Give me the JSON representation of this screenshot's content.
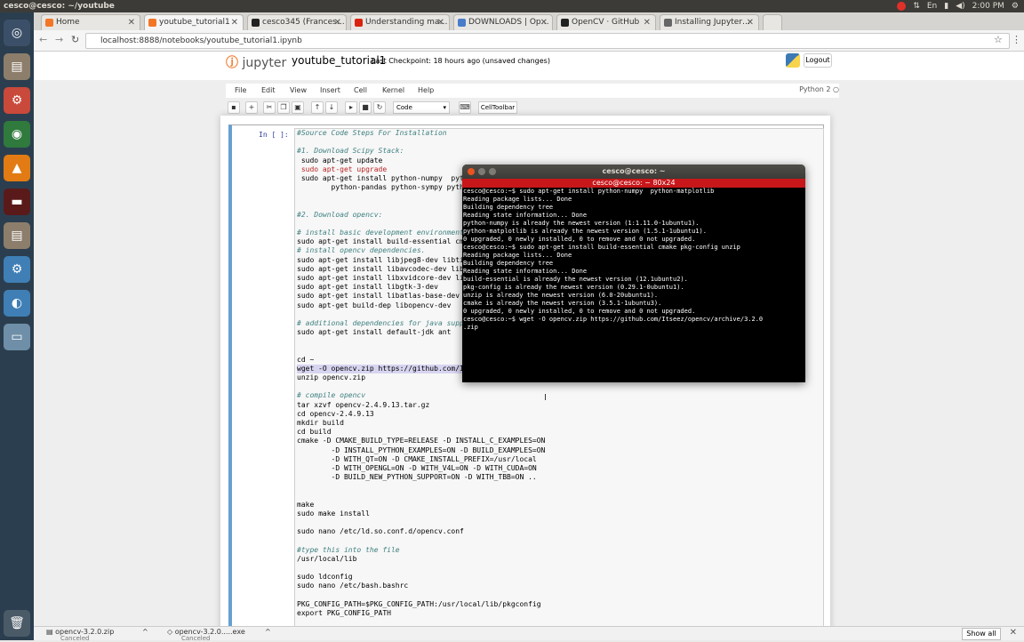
{
  "os": {
    "window_title": "cesco@cesco: ~/youtube",
    "time": "2:00 PM",
    "keyboard": "En",
    "launcher_icons": [
      "ubuntu-icon",
      "files-icon",
      "settings-icon",
      "chrome-icon",
      "vlc-icon",
      "terminal-icon",
      "files-icon",
      "settings-icon",
      "network-icon",
      "disk-icon",
      "trash-icon"
    ]
  },
  "browser": {
    "tabs": [
      {
        "label": "Home",
        "icon_color": "#f37626"
      },
      {
        "label": "youtube_tutorial1",
        "icon_color": "#f37626"
      },
      {
        "label": "cesco345 (Frances…",
        "icon_color": "#222222"
      },
      {
        "label": "Understanding ma…",
        "icon_color": "#d9230f"
      },
      {
        "label": "DOWNLOADS | Op…",
        "icon_color": "#4a7dc9"
      },
      {
        "label": "OpenCV · GitHub",
        "icon_color": "#222222"
      },
      {
        "label": "Installing Jupyter…",
        "icon_color": "#666666"
      }
    ],
    "url": "localhost:8888/notebooks/youtube_tutorial1.ipynb"
  },
  "jupyter": {
    "logo": "jupyter",
    "notebook_name": "youtube_tutorial1",
    "checkpoint": "Last Checkpoint: 18 hours ago (unsaved changes)",
    "logout": "Logout",
    "menus": [
      "File",
      "Edit",
      "View",
      "Insert",
      "Cell",
      "Kernel",
      "Help"
    ],
    "kernel": "Python 2",
    "cell_type": "Code",
    "cell_toolbar": "CellToolbar",
    "prompt": "In [ ]:"
  },
  "code_lines": [
    {
      "t": "#Source Code Steps For Installation",
      "c": "cm"
    },
    {
      "t": "",
      "c": ""
    },
    {
      "t": "#1. Download Scipy Stack:",
      "c": "cm"
    },
    {
      "t": " sudo apt-get update",
      "c": ""
    },
    {
      "t": " sudo apt-get upgrade",
      "c": "kwl"
    },
    {
      "t": " sudo apt-get install python-numpy  python-scipy python-matplotlib ipython ipython-notebook",
      "c": ""
    },
    {
      "t": "        python-pandas python-sympy python-nose",
      "c": ""
    },
    {
      "t": "",
      "c": ""
    },
    {
      "t": "",
      "c": ""
    },
    {
      "t": "#2. Download opencv:",
      "c": "cm"
    },
    {
      "t": "",
      "c": ""
    },
    {
      "t": "# install basic development environment",
      "c": "cm"
    },
    {
      "t": "sudo apt-get install build-essential cmake pkg-config unzip",
      "c": ""
    },
    {
      "t": "# install opencv dependencies.",
      "c": "cm"
    },
    {
      "t": "sudo apt-get install libjpeg8-dev libtiff4-dev libjasper-dev libpng12-dev",
      "c": ""
    },
    {
      "t": "sudo apt-get install libavcodec-dev libavformat-dev libswscale-dev libv4l-dev",
      "c": ""
    },
    {
      "t": "sudo apt-get install libxvidcore-dev libx264-dev",
      "c": ""
    },
    {
      "t": "sudo apt-get install libgtk-3-dev",
      "c": ""
    },
    {
      "t": "sudo apt-get install libatlas-base-dev gfortran",
      "c": ""
    },
    {
      "t": "sudo apt-get build-dep libopencv-dev",
      "c": ""
    },
    {
      "t": "",
      "c": ""
    },
    {
      "t": "# additional dependencies for java support",
      "c": "cm"
    },
    {
      "t": "sudo apt-get install default-jdk ant",
      "c": ""
    },
    {
      "t": "",
      "c": ""
    },
    {
      "t": "",
      "c": ""
    },
    {
      "t": "cd ~",
      "c": ""
    },
    {
      "t": "wget -O opencv.zip https://github.com/Itseez/opencv/archive/3.2.0.zip",
      "c": "hl"
    },
    {
      "t": "unzip opencv.zip",
      "c": ""
    },
    {
      "t": "",
      "c": ""
    },
    {
      "t": "# compile opencv",
      "c": "cm"
    },
    {
      "t": "tar xzvf opencv-2.4.9.13.tar.gz",
      "c": ""
    },
    {
      "t": "cd opencv-2.4.9.13",
      "c": ""
    },
    {
      "t": "mkdir build",
      "c": ""
    },
    {
      "t": "cd build",
      "c": ""
    },
    {
      "t": "cmake -D CMAKE_BUILD_TYPE=RELEASE -D INSTALL_C_EXAMPLES=ON",
      "c": ""
    },
    {
      "t": "        -D INSTALL_PYTHON_EXAMPLES=ON -D BUILD_EXAMPLES=ON",
      "c": ""
    },
    {
      "t": "        -D WITH_QT=ON -D CMAKE_INSTALL_PREFIX=/usr/local",
      "c": ""
    },
    {
      "t": "        -D WITH_OPENGL=ON -D WITH_V4L=ON -D WITH_CUDA=ON",
      "c": ""
    },
    {
      "t": "        -D BUILD_NEW_PYTHON_SUPPORT=ON -D WITH_TBB=ON ..",
      "c": ""
    },
    {
      "t": "",
      "c": ""
    },
    {
      "t": "",
      "c": ""
    },
    {
      "t": "make",
      "c": ""
    },
    {
      "t": "sudo make install",
      "c": ""
    },
    {
      "t": "",
      "c": ""
    },
    {
      "t": "sudo nano /etc/ld.so.conf.d/opencv.conf",
      "c": ""
    },
    {
      "t": "",
      "c": ""
    },
    {
      "t": "#type this into the file",
      "c": "cm"
    },
    {
      "t": "/usr/local/lib",
      "c": ""
    },
    {
      "t": "",
      "c": ""
    },
    {
      "t": "sudo ldconfig",
      "c": ""
    },
    {
      "t": "sudo nano /etc/bash.bashrc",
      "c": ""
    },
    {
      "t": "",
      "c": ""
    },
    {
      "t": "PKG_CONFIG_PATH=$PKG_CONFIG_PATH:/usr/local/lib/pkgconfig",
      "c": ""
    },
    {
      "t": "export PKG_CONFIG_PATH",
      "c": ""
    }
  ],
  "terminal": {
    "title": "cesco@cesco: ~",
    "tab_title": "cesco@cesco: ~ 80x24",
    "lines": [
      "cesco@cesco:~$ sudo apt-get install python-numpy  python-matplotlib",
      "Reading package lists... Done",
      "Building dependency tree",
      "Reading state information... Done",
      "python-numpy is already the newest version (1:1.11.0-1ubuntu1).",
      "python-matplotlib is already the newest version (1.5.1-1ubuntu1).",
      "0 upgraded, 0 newly installed, 0 to remove and 0 not upgraded.",
      "cesco@cesco:~$ sudo apt-get install build-essential cmake pkg-config unzip",
      "Reading package lists... Done",
      "Building dependency tree",
      "Reading state information... Done",
      "build-essential is already the newest version (12.1ubuntu2).",
      "pkg-config is already the newest version (0.29.1-0ubuntu1).",
      "unzip is already the newest version (6.0-20ubuntu1).",
      "cmake is already the newest version (3.5.1-1ubuntu3).",
      "0 upgraded, 0 newly installed, 0 to remove and 0 not upgraded.",
      "cesco@cesco:~$ wget -O opencv.zip https://github.com/Itseez/opencv/archive/3.2.0",
      ".zip"
    ]
  },
  "downloads": [
    {
      "name": "opencv-3.2.0.zip",
      "status": "Canceled"
    },
    {
      "name": "opencv-3.2.0.....exe",
      "status": "Canceled"
    }
  ],
  "show_all": "Show all"
}
